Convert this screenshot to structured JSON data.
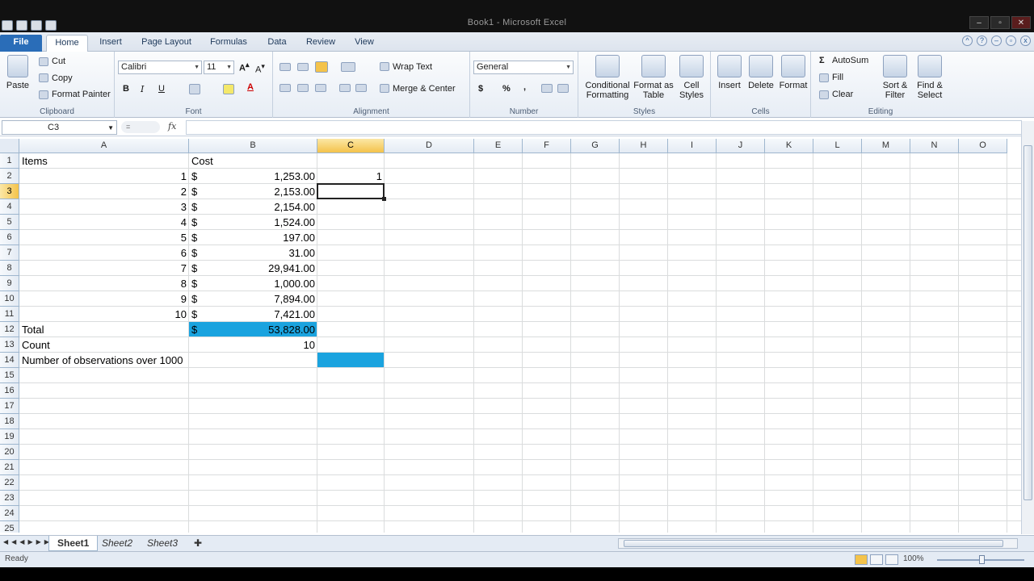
{
  "window": {
    "title": "Book1 - Microsoft Excel"
  },
  "ribbon_tabs": [
    "File",
    "Home",
    "Insert",
    "Page Layout",
    "Formulas",
    "Data",
    "Review",
    "View"
  ],
  "clipboard": {
    "paste": "Paste",
    "cut": "Cut",
    "copy": "Copy",
    "format_painter": "Format Painter",
    "label": "Clipboard"
  },
  "font": {
    "name": "Calibri",
    "size": "11",
    "bold": "B",
    "italic": "I",
    "underline": "U",
    "label": "Font"
  },
  "alignment": {
    "wrap": "Wrap Text",
    "merge": "Merge & Center",
    "label": "Alignment"
  },
  "number": {
    "format": "General",
    "currency": "$",
    "percent": "%",
    "comma": ",",
    "label": "Number"
  },
  "styles": {
    "conditional": "Conditional Formatting",
    "format_table": "Format as Table",
    "cell_styles": "Cell Styles",
    "label": "Styles"
  },
  "cells": {
    "insert": "Insert",
    "delete": "Delete",
    "format": "Format",
    "label": "Cells"
  },
  "editing": {
    "autosum": "AutoSum",
    "fill": "Fill",
    "clear": "Clear",
    "sort": "Sort & Filter",
    "find": "Find & Select",
    "label": "Editing"
  },
  "formula_bar": {
    "name_box": "C3",
    "fx": "fx",
    "formula": ""
  },
  "columns": [
    "A",
    "B",
    "C",
    "D",
    "E",
    "F",
    "G",
    "H",
    "I",
    "J",
    "K",
    "L",
    "M",
    "N",
    "O"
  ],
  "rows": [
    "1",
    "2",
    "3",
    "4",
    "5",
    "6",
    "7",
    "8",
    "9",
    "10",
    "11",
    "12",
    "13",
    "14",
    "15",
    "16",
    "17",
    "18",
    "19",
    "20",
    "21",
    "22",
    "23",
    "24",
    "25"
  ],
  "cells_data": {
    "a1": "Items",
    "b1": "Cost",
    "c2": "1",
    "items": [
      "1",
      "2",
      "3",
      "4",
      "5",
      "6",
      "7",
      "8",
      "9",
      "10"
    ],
    "costs": [
      "1,253.00",
      "2,153.00",
      "2,154.00",
      "1,524.00",
      "197.00",
      "31.00",
      "29,941.00",
      "1,000.00",
      "7,894.00",
      "7,421.00"
    ],
    "dollar": "$",
    "a12": "Total",
    "b12": "53,828.00",
    "a13": "Count",
    "b13": "10",
    "a14": "Number of observations over 1000"
  },
  "sheets": [
    "Sheet1",
    "Sheet2",
    "Sheet3"
  ],
  "status": {
    "ready": "Ready",
    "zoom": "100%"
  },
  "colors": {
    "fill": "#1aa3df",
    "selected_header": "#f4c34b"
  }
}
